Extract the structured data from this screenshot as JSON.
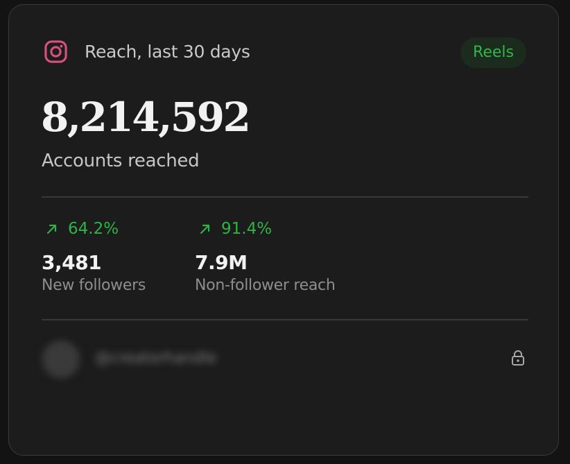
{
  "card": {
    "title": "Reach, last 30 days",
    "badge": "Reels",
    "icons": {
      "platform": "instagram-icon",
      "trend": "arrow-up-right-icon",
      "privacy": "lock-icon"
    },
    "colors": {
      "accent_green": "#2fb344",
      "instagram_pink": "#d9527d",
      "background": "#1c1c1c"
    }
  },
  "primary": {
    "value": "8,214,592",
    "label": "Accounts reached"
  },
  "stats": [
    {
      "change": "64.2%",
      "value": "3,481",
      "label": "New followers"
    },
    {
      "change": "91.4%",
      "value": "7.9M",
      "label": "Non-follower reach"
    }
  ],
  "footer": {
    "handle": "@creatorhandle"
  }
}
